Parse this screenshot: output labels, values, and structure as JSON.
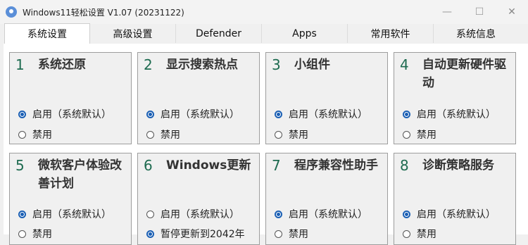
{
  "window": {
    "title": "Windows11轻松设置 V1.07 (20231122)",
    "minimize": "—",
    "maximize": "☐",
    "close": "✕"
  },
  "tabs": [
    {
      "label": "系统设置",
      "active": true
    },
    {
      "label": "高级设置",
      "active": false
    },
    {
      "label": "Defender",
      "active": false
    },
    {
      "label": "Apps",
      "active": false
    },
    {
      "label": "常用软件",
      "active": false
    },
    {
      "label": "系统信息",
      "active": false
    }
  ],
  "cards": [
    {
      "num": "1",
      "title": "系统还原",
      "options": [
        {
          "label": "启用（系统默认）",
          "selected": true
        },
        {
          "label": "禁用",
          "selected": false
        }
      ]
    },
    {
      "num": "2",
      "title": "显示搜索热点",
      "options": [
        {
          "label": "启用（系统默认）",
          "selected": true
        },
        {
          "label": "禁用",
          "selected": false
        }
      ]
    },
    {
      "num": "3",
      "title": "小组件",
      "options": [
        {
          "label": "启用（系统默认）",
          "selected": true
        },
        {
          "label": "禁用",
          "selected": false
        }
      ]
    },
    {
      "num": "4",
      "title": "自动更新硬件驱动",
      "options": [
        {
          "label": "启用（系统默认）",
          "selected": true
        },
        {
          "label": "禁用",
          "selected": false
        }
      ]
    },
    {
      "num": "5",
      "title": "微软客户体验改善计划",
      "options": [
        {
          "label": "启用（系统默认）",
          "selected": true
        },
        {
          "label": "禁用",
          "selected": false
        }
      ]
    },
    {
      "num": "6",
      "title": "Windows更新",
      "options": [
        {
          "label": "启用（系统默认）",
          "selected": false
        },
        {
          "label": "暂停更新到2042年",
          "selected": true
        }
      ]
    },
    {
      "num": "7",
      "title": "程序兼容性助手",
      "options": [
        {
          "label": "启用（系统默认）",
          "selected": true
        },
        {
          "label": "禁用",
          "selected": false
        }
      ]
    },
    {
      "num": "8",
      "title": "诊断策略服务",
      "options": [
        {
          "label": "启用（系统默认）",
          "selected": true
        },
        {
          "label": "禁用",
          "selected": false
        }
      ]
    }
  ],
  "colors": {
    "accent": "#1a5fb4",
    "number": "#1e6b50",
    "card_border": "#9d9d9d"
  }
}
